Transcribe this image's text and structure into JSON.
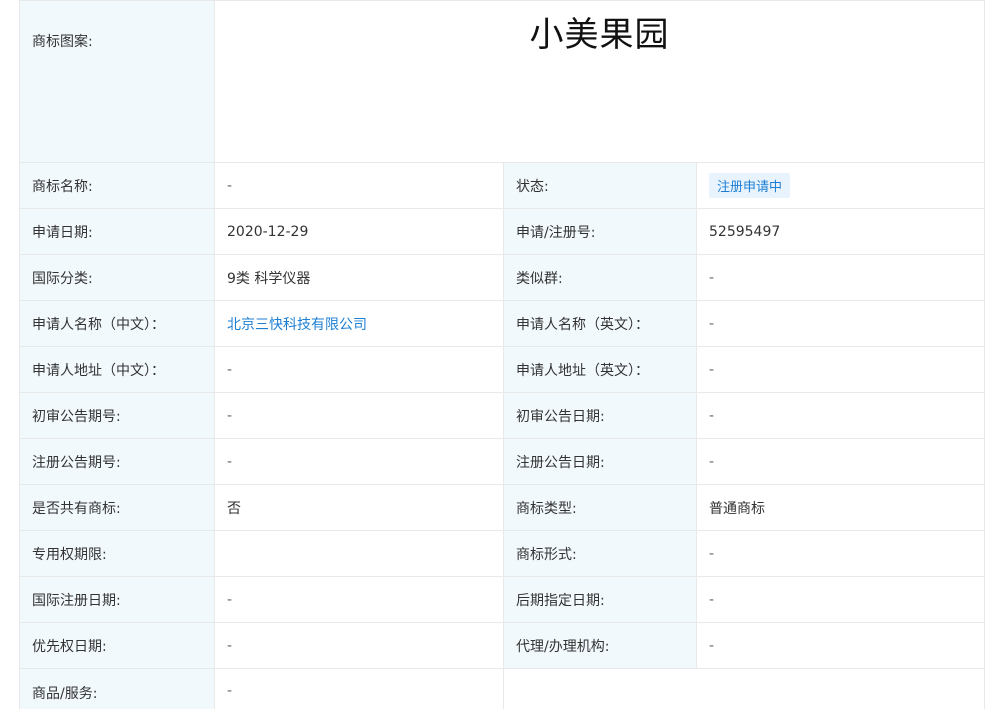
{
  "trademark": {
    "logo_label": "商标图案:",
    "logo_text": "小美果园"
  },
  "rows": [
    {
      "l_label": "商标名称:",
      "l_value": "-",
      "r_label": "状态:",
      "r_value": "注册申请中"
    },
    {
      "l_label": "申请日期:",
      "l_value": "2020-12-29",
      "r_label": "申请/注册号:",
      "r_value": "52595497"
    },
    {
      "l_label": "国际分类:",
      "l_value": "9类 科学仪器",
      "r_label": "类似群:",
      "r_value": "-"
    },
    {
      "l_label": "申请人名称（中文）：",
      "l_value": "北京三快科技有限公司",
      "r_label": "申请人名称（英文）：",
      "r_value": "-"
    },
    {
      "l_label": "申请人地址（中文）：",
      "l_value": "-",
      "r_label": "申请人地址（英文）：",
      "r_value": "-"
    },
    {
      "l_label": "初审公告期号:",
      "l_value": "-",
      "r_label": "初审公告日期:",
      "r_value": "-"
    },
    {
      "l_label": "注册公告期号:",
      "l_value": "-",
      "r_label": "注册公告日期:",
      "r_value": "-"
    },
    {
      "l_label": "是否共有商标:",
      "l_value": "否",
      "r_label": "商标类型:",
      "r_value": "普通商标"
    },
    {
      "l_label": "专用权期限:",
      "l_value": "",
      "r_label": "商标形式:",
      "r_value": "-"
    },
    {
      "l_label": "国际注册日期:",
      "l_value": "-",
      "r_label": "后期指定日期:",
      "r_value": "-"
    },
    {
      "l_label": "优先权日期:",
      "l_value": "-",
      "r_label": "代理/办理机构:",
      "r_value": "-"
    }
  ],
  "goods": {
    "label": "商品/服务:",
    "value": "-"
  },
  "colors": {
    "label_bg": "#f2f9fd",
    "link": "#1d7fd4",
    "badge_bg": "#e8f3fd",
    "border": "#e9e9e9"
  }
}
